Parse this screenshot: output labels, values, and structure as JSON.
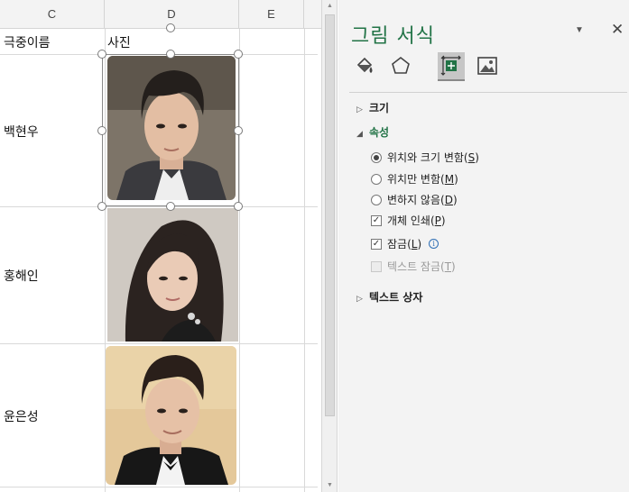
{
  "sheet": {
    "columns": [
      "C",
      "D",
      "E"
    ],
    "header_row": {
      "c": "극중이름",
      "d": "사진"
    },
    "rows": [
      {
        "name": "백현우",
        "photo": "portrait-man-1"
      },
      {
        "name": "홍해인",
        "photo": "portrait-woman"
      },
      {
        "name": "윤은성",
        "photo": "portrait-man-2"
      }
    ]
  },
  "pane": {
    "title": "그림 서식",
    "menu_icon": "chevron-down-icon",
    "close_icon": "close-icon",
    "tabs": [
      {
        "icon": "fill-line-icon",
        "active": false
      },
      {
        "icon": "effects-pentagon-icon",
        "active": false
      },
      {
        "icon": "size-properties-icon",
        "active": true
      },
      {
        "icon": "picture-icon",
        "active": false
      }
    ],
    "sections": {
      "size": "크기",
      "properties": "속성",
      "textbox": "텍스트 상자"
    },
    "properties": {
      "move_and_size": "위치와 크기 변함",
      "move_and_size_key": "S",
      "move_only": "위치만 변함",
      "move_only_key": "M",
      "dont_move": "변하지 않음",
      "dont_move_key": "D",
      "print_object": "개체 인쇄",
      "print_object_key": "P",
      "locked": "잠금",
      "locked_key": "L",
      "lock_text": "텍스트 잠금",
      "lock_text_key": "T",
      "selected_radio": "move_and_size",
      "print_object_checked": true,
      "locked_checked": true,
      "lock_text_enabled": false
    }
  },
  "colors": {
    "accent": "#217346",
    "pane_bg": "#f3f3f3",
    "grid": "#d9d9d9"
  }
}
